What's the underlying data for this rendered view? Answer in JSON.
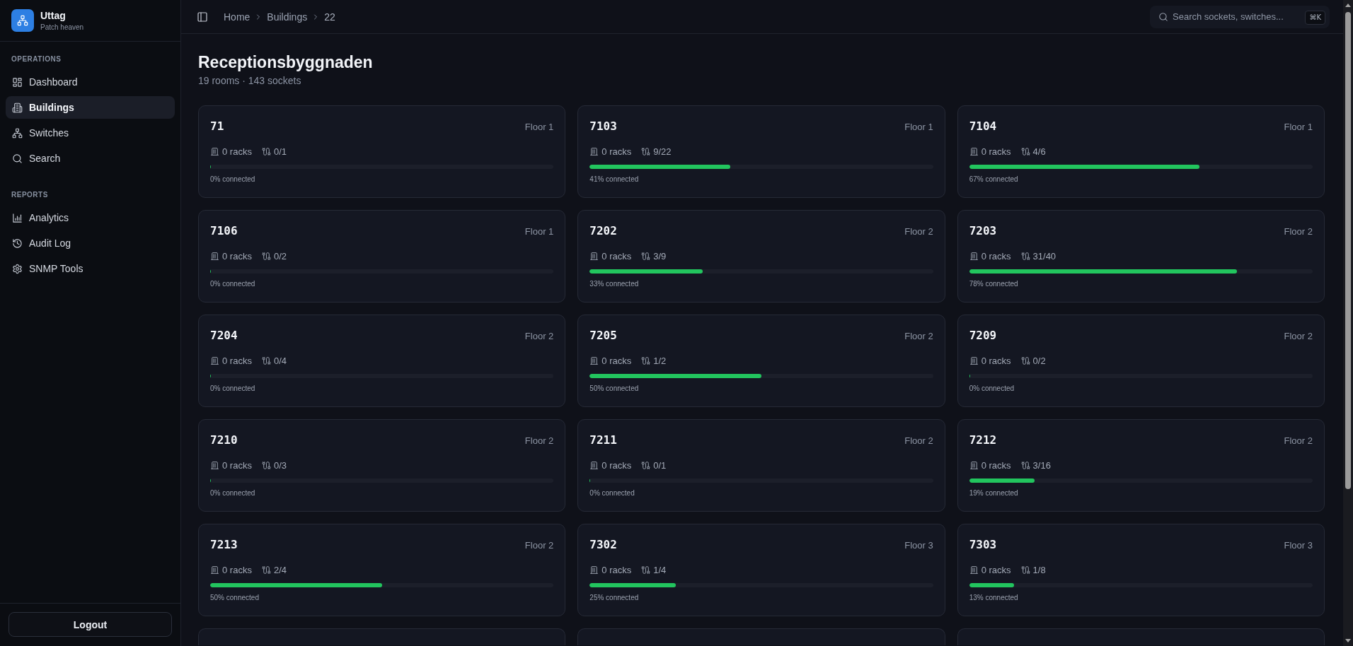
{
  "sidebar": {
    "brand": {
      "title": "Uttag",
      "subtitle": "Patch heaven"
    },
    "sections": [
      {
        "label": "OPERATIONS",
        "items": [
          {
            "label": "Dashboard",
            "selected": false
          },
          {
            "label": "Buildings",
            "selected": true
          },
          {
            "label": "Switches",
            "selected": false
          },
          {
            "label": "Search",
            "selected": false
          }
        ]
      },
      {
        "label": "REPORTS",
        "items": [
          {
            "label": "Analytics",
            "selected": false
          },
          {
            "label": "Audit Log",
            "selected": false
          },
          {
            "label": "SNMP Tools",
            "selected": false
          }
        ]
      }
    ],
    "logout": "Logout"
  },
  "topbar": {
    "breadcrumb": [
      "Home",
      "Buildings",
      "22"
    ],
    "search": {
      "placeholder": "Search sockets, switches...",
      "shortcut": "⌘K"
    }
  },
  "page": {
    "title": "Receptionsbyggnaden",
    "summary": "19 rooms · 143 sockets"
  },
  "rooms": [
    {
      "kind": "room",
      "number": "71",
      "floor": "Floor 1",
      "racks": "0 racks",
      "sockets": "0/1",
      "level": 0,
      "connected": "0% connected"
    },
    {
      "kind": "room",
      "number": "7103",
      "floor": "Floor 1",
      "racks": "0 racks",
      "sockets": "9/22",
      "level": 0.41,
      "connected": "41% connected"
    },
    {
      "kind": "room",
      "number": "7104",
      "floor": "Floor 1",
      "racks": "0 racks",
      "sockets": "4/6",
      "level": 0.67,
      "connected": "67% connected"
    },
    {
      "kind": "room",
      "number": "7106",
      "floor": "Floor 1",
      "racks": "0 racks",
      "sockets": "0/2",
      "level": 0,
      "connected": "0% connected"
    },
    {
      "kind": "room",
      "number": "7202",
      "floor": "Floor 2",
      "racks": "0 racks",
      "sockets": "3/9",
      "level": 0.33,
      "connected": "33% connected"
    },
    {
      "kind": "room",
      "number": "7203",
      "floor": "Floor 2",
      "racks": "0 racks",
      "sockets": "31/40",
      "level": 0.78,
      "connected": "78% connected"
    },
    {
      "kind": "room",
      "number": "7204",
      "floor": "Floor 2",
      "racks": "0 racks",
      "sockets": "0/4",
      "level": 0,
      "connected": "0% connected"
    },
    {
      "kind": "room",
      "number": "7205",
      "floor": "Floor 2",
      "racks": "0 racks",
      "sockets": "1/2",
      "level": 0.5,
      "connected": "50% connected"
    },
    {
      "kind": "room",
      "number": "7209",
      "floor": "Floor 2",
      "racks": "0 racks",
      "sockets": "0/2",
      "level": 0,
      "connected": "0% connected"
    },
    {
      "kind": "room",
      "number": "7210",
      "floor": "Floor 2",
      "racks": "0 racks",
      "sockets": "0/3",
      "level": 0,
      "connected": "0% connected"
    },
    {
      "kind": "room",
      "number": "7211",
      "floor": "Floor 2",
      "racks": "0 racks",
      "sockets": "0/1",
      "level": 0,
      "connected": "0% connected"
    },
    {
      "kind": "room",
      "number": "7212",
      "floor": "Floor 2",
      "racks": "0 racks",
      "sockets": "3/16",
      "level": 0.19,
      "connected": "19% connected"
    },
    {
      "kind": "room",
      "number": "7213",
      "floor": "Floor 2",
      "racks": "0 racks",
      "sockets": "2/4",
      "level": 0.5,
      "connected": "50% connected"
    },
    {
      "kind": "room",
      "number": "7302",
      "floor": "Floor 3",
      "racks": "0 racks",
      "sockets": "1/4",
      "level": 0.25,
      "connected": "25% connected"
    },
    {
      "kind": "room",
      "number": "7303",
      "floor": "Floor 3",
      "racks": "0 racks",
      "sockets": "1/8",
      "level": 0.13,
      "connected": "13% connected"
    },
    {
      "kind": "cut_off"
    },
    {
      "kind": "cut_off"
    },
    {
      "kind": "cut_off"
    }
  ]
}
